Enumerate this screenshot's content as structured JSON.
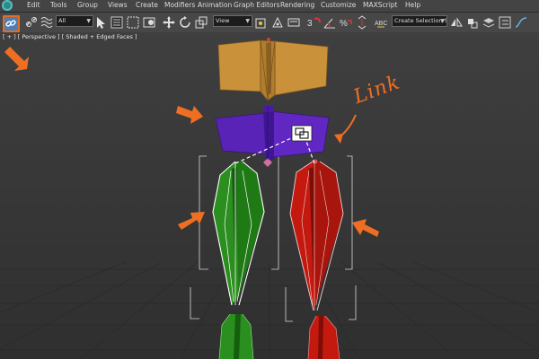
{
  "menu": {
    "items": [
      "Edit",
      "Tools",
      "Group",
      "Views",
      "Create",
      "Modifiers",
      "Animation",
      "Graph Editors",
      "Rendering",
      "Customize",
      "MAXScript",
      "Help"
    ]
  },
  "toolbar": {
    "selection_filter": "All",
    "reference_coord": "View",
    "selection_set_placeholder": "Create Selection Se"
  },
  "viewport": {
    "label": "[ + ] [ Perspective ] [ Shaded + Edged Faces ]"
  },
  "annotation": {
    "text": "Link"
  },
  "colors": {
    "accent_orange": "#ef6f22",
    "head": "#c8913a",
    "pelvis": "#5a23b8",
    "left_thigh": "#2b8f1f",
    "right_thigh": "#c4190f",
    "selection_white": "#ffffff"
  }
}
